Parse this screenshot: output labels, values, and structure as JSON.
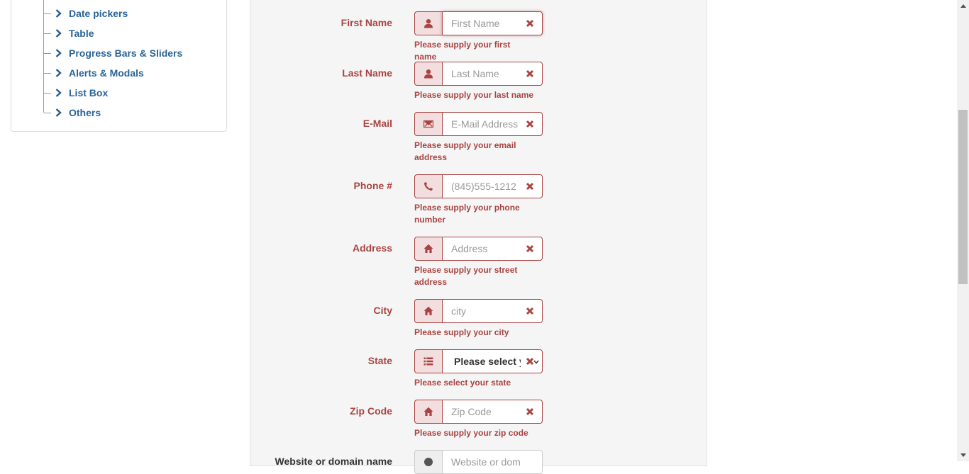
{
  "sidebar": {
    "items": [
      {
        "label": "Date pickers"
      },
      {
        "label": "Table"
      },
      {
        "label": "Progress Bars & Sliders"
      },
      {
        "label": "Alerts & Modals"
      },
      {
        "label": "List Box"
      },
      {
        "label": "Others"
      }
    ]
  },
  "form": {
    "first_name": {
      "label": "First Name",
      "placeholder": "First Name",
      "help": "Please supply your first name"
    },
    "last_name": {
      "label": "Last Name",
      "placeholder": "Last Name",
      "help": "Please supply your last name"
    },
    "email": {
      "label": "E-Mail",
      "placeholder": "E-Mail Address",
      "help": "Please supply your email address"
    },
    "phone": {
      "label": "Phone #",
      "placeholder": "(845)555-1212",
      "help": "Please supply your phone number"
    },
    "address": {
      "label": "Address",
      "placeholder": "Address",
      "help": "Please supply your street address"
    },
    "city": {
      "label": "City",
      "placeholder": "city",
      "help": "Please supply your city"
    },
    "state": {
      "label": "State",
      "selected": "Please select your state",
      "help": "Please select your state"
    },
    "zip": {
      "label": "Zip Code",
      "placeholder": "Zip Code",
      "help": "Please supply your zip code"
    },
    "website": {
      "label": "Website or domain name",
      "placeholder": "Website or domain name"
    }
  },
  "colors": {
    "error": "#a94442",
    "error_bg": "#f2dede",
    "link": "#2a6496",
    "panel_bg": "#f5f5f5"
  },
  "icons": {
    "sidebar_item": "chevron-right-icon",
    "first_name": "user-icon",
    "last_name": "user-icon",
    "email": "envelope-icon",
    "phone": "phone-icon",
    "address": "home-icon",
    "city": "home-icon",
    "state": "list-icon",
    "zip": "home-icon",
    "website": "globe-icon",
    "invalid": "remove-icon"
  }
}
